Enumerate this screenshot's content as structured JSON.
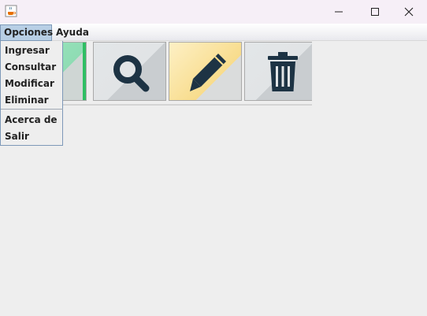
{
  "window": {
    "app_icon": "java-cup-icon",
    "controls": [
      "minimize-icon",
      "maximize-icon",
      "close-icon"
    ]
  },
  "menubar": {
    "menus": [
      {
        "label": "Opciones",
        "active": true
      },
      {
        "label": "Ayuda",
        "active": false
      }
    ]
  },
  "dropdown": {
    "items": [
      {
        "label": "Ingresar"
      },
      {
        "label": "Consultar"
      },
      {
        "label": "Modificar"
      },
      {
        "label": "Eliminar"
      },
      {
        "label": "Acerca de"
      },
      {
        "label": "Salir"
      }
    ]
  },
  "toolbar": {
    "buttons": [
      {
        "icon": "add-icon",
        "color": "#8fdcb4"
      },
      {
        "icon": "search-icon",
        "color": "#e1e4e6"
      },
      {
        "icon": "pencil-icon",
        "color": "#f8dc8c"
      },
      {
        "icon": "trash-icon",
        "color": "#e1e4e6"
      }
    ],
    "icon_color": "#1d3344"
  }
}
